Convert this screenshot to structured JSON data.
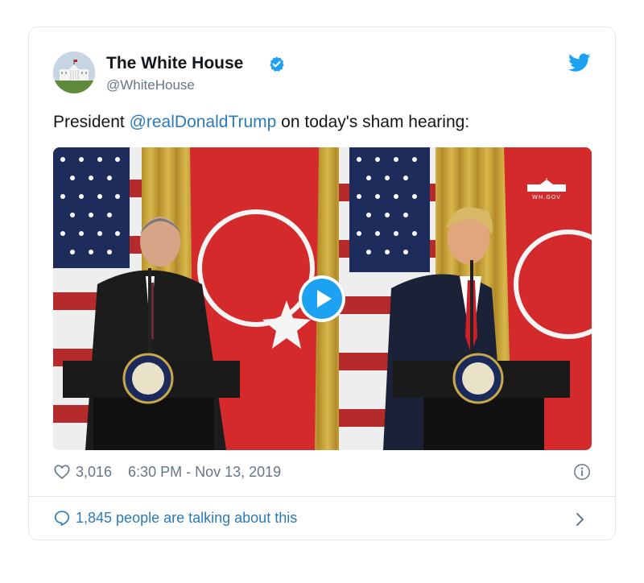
{
  "account": {
    "name": "The White House",
    "handle": "@WhiteHouse",
    "verified_icon": "verified-badge-icon",
    "logo_icon": "twitter-bird-icon"
  },
  "tweet": {
    "text_before": "President ",
    "mention": "@realDonaldTrump",
    "text_after": " on today's sham hearing:"
  },
  "media": {
    "watermark": "WH.GOV",
    "play_icon": "play-icon"
  },
  "meta": {
    "likes": "3,016",
    "timestamp": "6:30 PM - Nov 13, 2019",
    "like_icon": "heart-icon",
    "info_icon": "info-icon"
  },
  "footer": {
    "talking": "1,845 people are talking about this",
    "chevron_icon": "chevron-right-icon"
  },
  "colors": {
    "link": "#2b7bb9",
    "twitter_blue": "#1da1f2",
    "secondary_text": "#657786",
    "border": "#e1e8ed"
  }
}
